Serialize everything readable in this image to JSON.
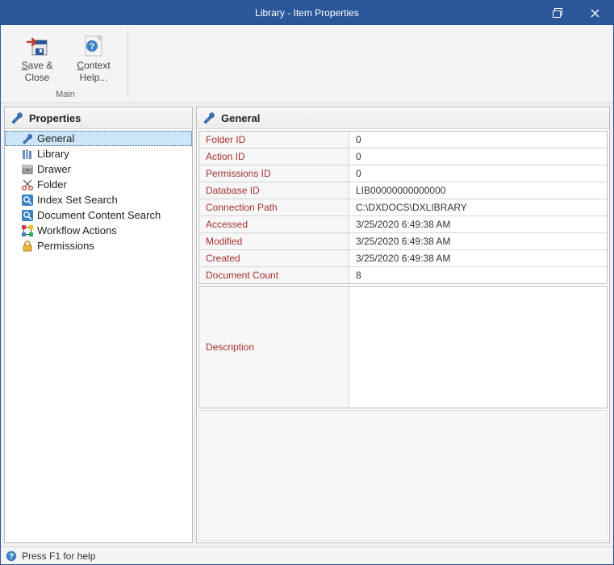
{
  "title": "Library - Item Properties",
  "ribbon": {
    "save_close_l1": "Save &",
    "save_close_l2": "Close",
    "context_help_l1": "Context",
    "context_help_l2": "Help...",
    "group_label": "Main"
  },
  "left": {
    "header": "Properties",
    "items": [
      {
        "label": "General"
      },
      {
        "label": "Library"
      },
      {
        "label": "Drawer"
      },
      {
        "label": "Folder"
      },
      {
        "label": "Index Set Search"
      },
      {
        "label": "Document Content Search"
      },
      {
        "label": "Workflow Actions"
      },
      {
        "label": "Permissions"
      }
    ]
  },
  "right": {
    "header": "General",
    "rows": [
      {
        "label": "Folder ID",
        "value": "0"
      },
      {
        "label": "Action ID",
        "value": "0"
      },
      {
        "label": "Permissions ID",
        "value": "0"
      },
      {
        "label": "Database ID",
        "value": "LIB00000000000000"
      },
      {
        "label": "Connection Path",
        "value": "C:\\DXDOCS\\DXLIBRARY"
      },
      {
        "label": "Accessed",
        "value": "3/25/2020 6:49:38 AM"
      },
      {
        "label": "Modified",
        "value": "3/25/2020 6:49:38 AM"
      },
      {
        "label": "Created",
        "value": "3/25/2020 6:49:38 AM"
      },
      {
        "label": "Document Count",
        "value": "8"
      }
    ],
    "description_label": "Description",
    "description_value": ""
  },
  "status": "Press F1 for help"
}
